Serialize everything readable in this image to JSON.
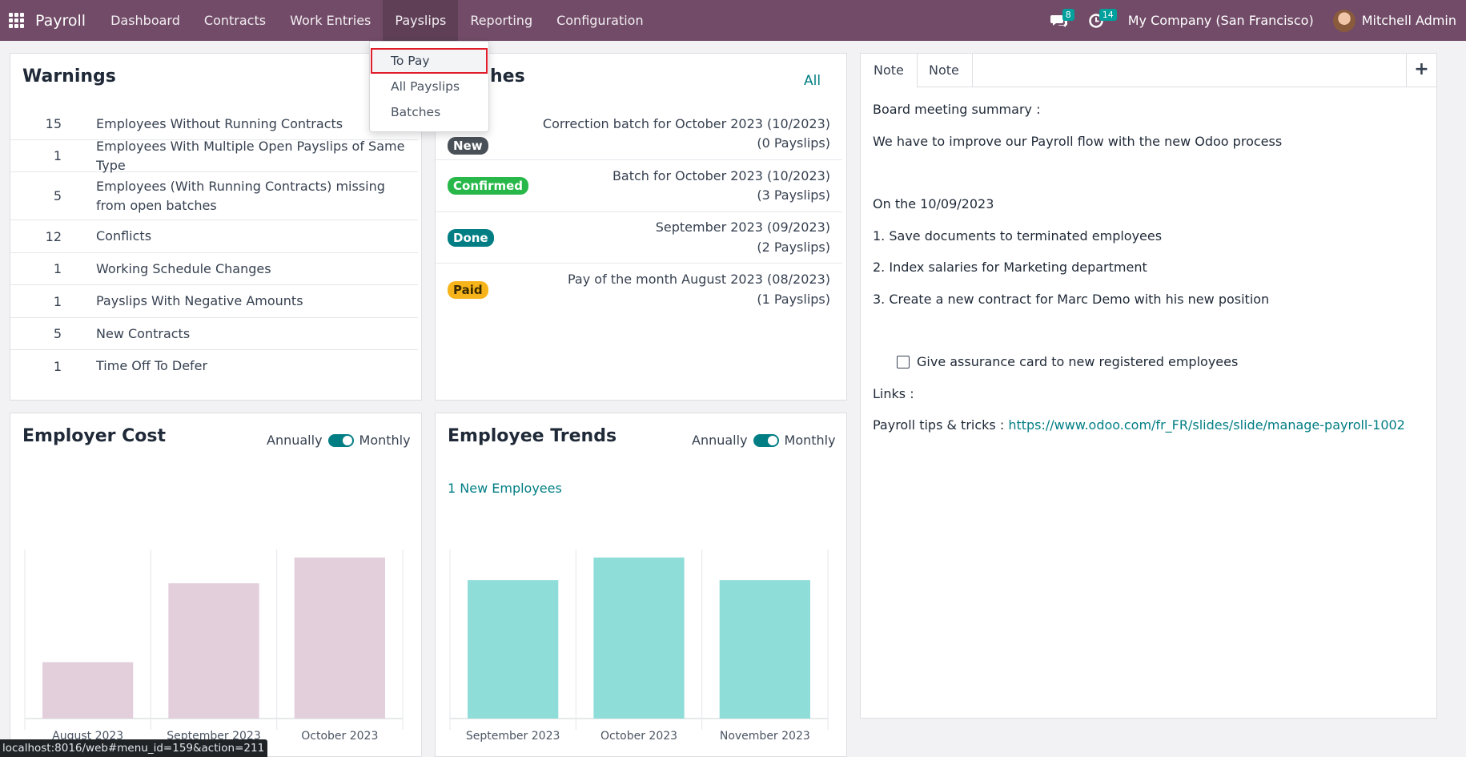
{
  "navbar": {
    "brand": "Payroll",
    "menu": [
      "Dashboard",
      "Contracts",
      "Work Entries",
      "Payslips",
      "Reporting",
      "Configuration"
    ],
    "messages_badge": "8",
    "activities_badge": "14",
    "company": "My Company (San Francisco)",
    "user": "Mitchell Admin"
  },
  "payslips_dropdown": [
    "To Pay",
    "All Payslips",
    "Batches"
  ],
  "warnings": {
    "title": "Warnings",
    "rows": [
      {
        "count": "15",
        "label": "Employees Without Running Contracts"
      },
      {
        "count": "1",
        "label": "Employees With Multiple Open Payslips of Same Type"
      },
      {
        "count": "5",
        "label": "Employees (With Running Contracts) missing from open batches"
      },
      {
        "count": "12",
        "label": "Conflicts"
      },
      {
        "count": "1",
        "label": "Working Schedule Changes"
      },
      {
        "count": "1",
        "label": "Payslips With Negative Amounts"
      },
      {
        "count": "5",
        "label": "New Contracts"
      },
      {
        "count": "1",
        "label": "Time Off To Defer"
      }
    ]
  },
  "batches": {
    "title_visible": "hes",
    "all_link": "All",
    "rows": [
      {
        "status": "New",
        "color": "#495057",
        "name": "Correction batch for October 2023 (10/2023)",
        "count": "(0 Payslips)"
      },
      {
        "status": "Confirmed",
        "color": "#28a745",
        "name": "Batch for October 2023 (10/2023)",
        "count": "(3 Payslips)"
      },
      {
        "status": "Done",
        "color": "#017e84",
        "name": "September 2023 (09/2023)",
        "count": "(2 Payslips)"
      },
      {
        "status": "Paid",
        "color": "#f0ad00",
        "name": "Pay of the month August 2023 (08/2023)",
        "count": "(1 Payslips)"
      }
    ]
  },
  "note": {
    "tabs": [
      "Note",
      "Note"
    ],
    "add_label": "+",
    "lines": {
      "l1": "Board meeting summary :",
      "l2": "We have to improve our Payroll flow with the new Odoo process",
      "l3": "On the 10/09/2023",
      "l4": "1. Save documents to terminated employees",
      "l5": "2. Index salaries for Marketing department",
      "l6": "3. Create a new contract for Marc Demo with his new position",
      "todo": "Give assurance card to new registered employees",
      "links": "Links :",
      "tips_prefix": "Payroll tips & tricks : ",
      "tips_url": "https://www.odoo.com/fr_FR/slides/slide/manage-payroll-1002"
    }
  },
  "employer_cost": {
    "title": "Employer Cost",
    "toggle_left": "Annually",
    "toggle_right": "Monthly"
  },
  "employee_trends": {
    "title": "Employee Trends",
    "toggle_left": "Annually",
    "toggle_right": "Monthly",
    "new_employees": "1 New Employees"
  },
  "chart_data": [
    {
      "type": "bar",
      "title": "Employer Cost",
      "categories": [
        "August 2023",
        "September 2023",
        "October 2023"
      ],
      "values": [
        35,
        84,
        100
      ],
      "ylim": [
        0,
        100
      ],
      "grid": false,
      "color": "#e2cfdb"
    },
    {
      "type": "bar",
      "title": "Employee Trends",
      "categories": [
        "September 2023",
        "October 2023",
        "November 2023"
      ],
      "values": [
        86,
        100,
        86
      ],
      "ylim": [
        0,
        100
      ],
      "grid": false,
      "color": "#8fddd8"
    }
  ],
  "statusbar": "localhost:8016/web#menu_id=159&action=211"
}
